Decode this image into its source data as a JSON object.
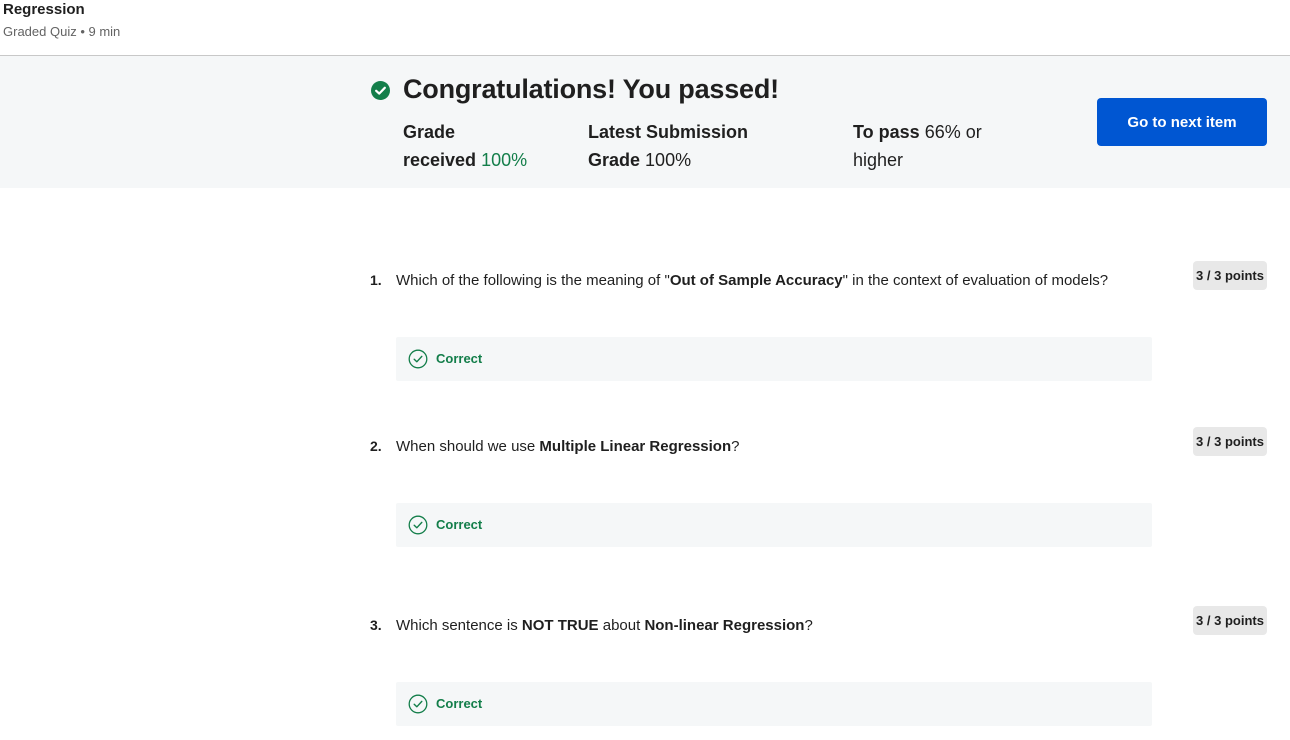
{
  "header": {
    "title": "Regression",
    "subtitle": "Graded Quiz • 9 min"
  },
  "banner": {
    "headline": "Congratulations! You passed!",
    "grade_label_line1": "Grade",
    "grade_label_line2": "received",
    "grade_value": "100%",
    "latest_label_line1": "Latest Submission",
    "latest_label_line2": "Grade",
    "latest_value": "100%",
    "to_pass_label": "To pass",
    "to_pass_value_line1": "66% or",
    "to_pass_value_line2": "higher",
    "next_button": "Go to next item"
  },
  "questions": [
    {
      "number": "1.",
      "text_before": "Which of the following is the meaning of \"",
      "text_bold": "Out of Sample Accuracy",
      "text_after": "\" in the context of evaluation of models?",
      "points": "3 / 3 points",
      "feedback": "Correct"
    },
    {
      "number": "2.",
      "text_before": "When should we use ",
      "text_bold": "Multiple Linear Regression",
      "text_after": "?",
      "points": "3 / 3 points",
      "feedback": "Correct"
    },
    {
      "number": "3.",
      "text_before": "Which sentence is ",
      "text_bold": "NOT TRUE",
      "text_mid": " about ",
      "text_bold2": "Non-linear Regression",
      "text_after": "?",
      "points": "3 / 3 points",
      "feedback": "Correct"
    }
  ],
  "colors": {
    "accent": "#0056d2",
    "success": "#137e4a",
    "banner_bg": "#f5f7f8"
  }
}
